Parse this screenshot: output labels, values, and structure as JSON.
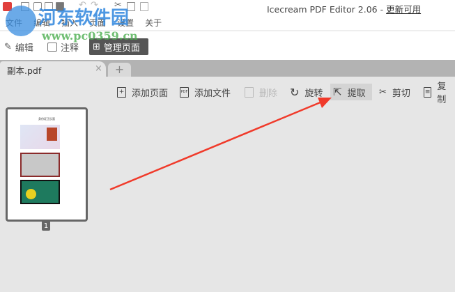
{
  "window": {
    "title": "Icecream PDF Editor 2.06 - ",
    "update_link": "更新可用"
  },
  "menu": [
    "文件",
    "编辑",
    "插入",
    "页面",
    "设置",
    "关于"
  ],
  "modes": [
    {
      "label": "编辑",
      "icon": "pencil-icon"
    },
    {
      "label": "注释",
      "icon": "comment-icon"
    },
    {
      "label": "管理页面",
      "icon": "grid-icon"
    }
  ],
  "tab": {
    "label": "副本.pdf",
    "close": "×",
    "add": "+"
  },
  "toolbar": [
    {
      "label": "添加页面",
      "icon": "add-page-icon"
    },
    {
      "label": "添加文件",
      "icon": "add-file-icon"
    },
    {
      "label": "删除",
      "icon": "trash-icon"
    },
    {
      "label": "旋转",
      "icon": "rotate-icon"
    },
    {
      "label": "提取",
      "icon": "extract-icon"
    },
    {
      "label": "剪切",
      "icon": "scissors-icon"
    },
    {
      "label": "复制",
      "icon": "copy-icon"
    }
  ],
  "page": {
    "number": "1",
    "doc_title": "身份证正反面"
  },
  "watermark": {
    "name": "河东软件园",
    "url": "www.pc0359.cn"
  },
  "colors": {
    "arrow": "#f03a2a",
    "active_mode": "#555555"
  }
}
